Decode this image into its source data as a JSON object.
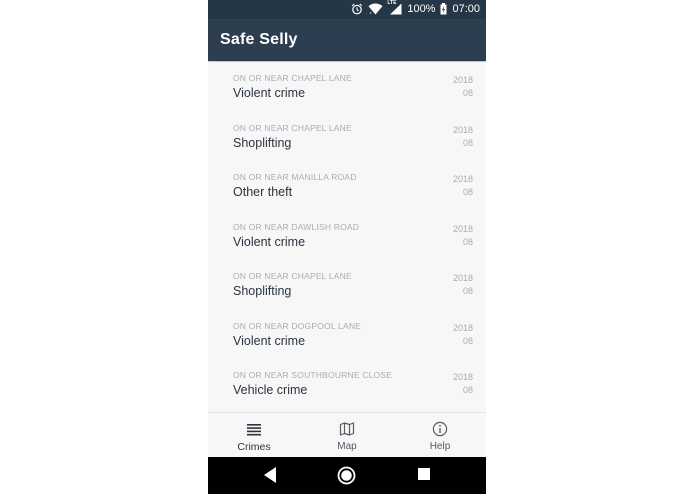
{
  "status": {
    "battery": "100%",
    "time": "07:00",
    "network_badge": "LTE",
    "icons": [
      "alarm-icon",
      "wifi-icon",
      "signal-icon",
      "battery-icon"
    ]
  },
  "app": {
    "title": "Safe Selly"
  },
  "crimes": [
    {
      "location": "ON OR NEAR CHAPEL LANE",
      "type": "Violent crime",
      "year": "2018",
      "month": "08"
    },
    {
      "location": "ON OR NEAR CHAPEL LANE",
      "type": "Shoplifting",
      "year": "2018",
      "month": "08"
    },
    {
      "location": "ON OR NEAR MANILLA ROAD",
      "type": "Other theft",
      "year": "2018",
      "month": "08"
    },
    {
      "location": "ON OR NEAR DAWLISH ROAD",
      "type": "Violent crime",
      "year": "2018",
      "month": "08"
    },
    {
      "location": "ON OR NEAR CHAPEL LANE",
      "type": "Shoplifting",
      "year": "2018",
      "month": "08"
    },
    {
      "location": "ON OR NEAR DOGPOOL LANE",
      "type": "Violent crime",
      "year": "2018",
      "month": "08"
    },
    {
      "location": "ON OR NEAR SOUTHBOURNE CLOSE",
      "type": "Vehicle crime",
      "year": "2018",
      "month": "08"
    }
  ],
  "nav": {
    "crimes": "Crimes",
    "map": "Map",
    "help": "Help",
    "active": "crimes",
    "icons": {
      "crimes": "list-icon",
      "map": "map-icon",
      "help": "info-icon"
    }
  },
  "colors": {
    "appbar": "#2d3e50",
    "statusbar": "#253746",
    "background": "#f7f7f7",
    "muted_text": "#a9adb2",
    "primary_text": "#2b3440"
  }
}
